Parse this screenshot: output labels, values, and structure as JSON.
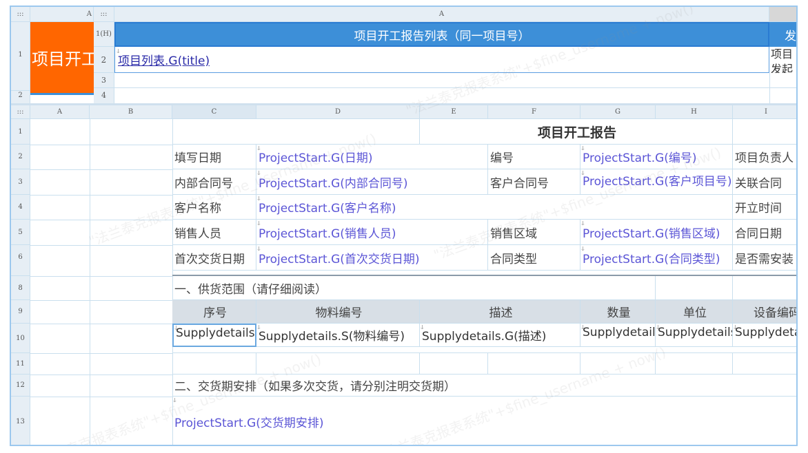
{
  "top": {
    "corner_left": ":::",
    "col_a_left": "A",
    "corner_right": ":::",
    "col_a_right": "A",
    "rows_left": [
      "1",
      "2"
    ],
    "rows_right": [
      "1(H)",
      "2",
      "3",
      "4"
    ],
    "orange_title": "项目开工",
    "list_title": "项目开工报告列表（同一项目号）",
    "list_field": "项目列表.G(title)",
    "right_cut_top": "发",
    "right_cut_mid": "项目",
    "right_cut_bottom": "发起"
  },
  "grid": {
    "corner": ":::",
    "columns": [
      "A",
      "B",
      "C",
      "D",
      "E",
      "F",
      "G",
      "H",
      "I"
    ],
    "rows": [
      "1",
      "2",
      "3",
      "4",
      "5",
      "6",
      "8",
      "9",
      "10",
      "11",
      "12",
      "13"
    ]
  },
  "report": {
    "title": "项目开工报告",
    "fill_date_label": "填写日期",
    "fill_date_value": "ProjectStart.G(日期)",
    "number_label": "编号",
    "number_value": "ProjectStart.G(编号)",
    "pm_label": "项目负责人",
    "internal_contract_label": "内部合同号",
    "internal_contract_value": "ProjectStart.G(内部合同号)",
    "customer_contract_label": "客户合同号",
    "customer_contract_value": "ProjectStart.G(客户项目号)",
    "related_contract_label": "关联合同",
    "customer_name_label": "客户名称",
    "customer_name_value": "ProjectStart.G(客户名称)",
    "open_time_label": "开立时间",
    "sales_label": "销售人员",
    "sales_value": "ProjectStart.G(销售人员)",
    "sales_region_label": "销售区域",
    "sales_region_value": "ProjectStart.G(销售区域)",
    "contract_date_label": "合同日期",
    "first_delivery_label": "首次交货日期",
    "first_delivery_value": "ProjectStart.G(首次交货日期)",
    "contract_type_label": "合同类型",
    "contract_type_value": "ProjectStart.G(合同类型)",
    "install_label": "是否需安装",
    "supply_section": "一、供货范围（请仔细阅读）",
    "supply_headers": [
      "序号",
      "物料编号",
      "描述",
      "数量",
      "单位",
      "设备编码"
    ],
    "supply_row": [
      "Supplydetails",
      "Supplydetails.S(物料编号)",
      "Supplydetails.G(描述)",
      "Supplydetails",
      "Supplydetails",
      "Supplydetails"
    ],
    "delivery_section": "二、交货期安排（如果多次交货，请分别注明交货期）",
    "delivery_value": "ProjectStart.G(交货期安排)"
  },
  "watermark": "\"法兰泰克报表系统\"+$fine_username + now()",
  "colors": {
    "orange": "#ff6600",
    "blue_header": "#3d8fd8",
    "link": "#5b55d6",
    "grid": "#c9dfee"
  }
}
